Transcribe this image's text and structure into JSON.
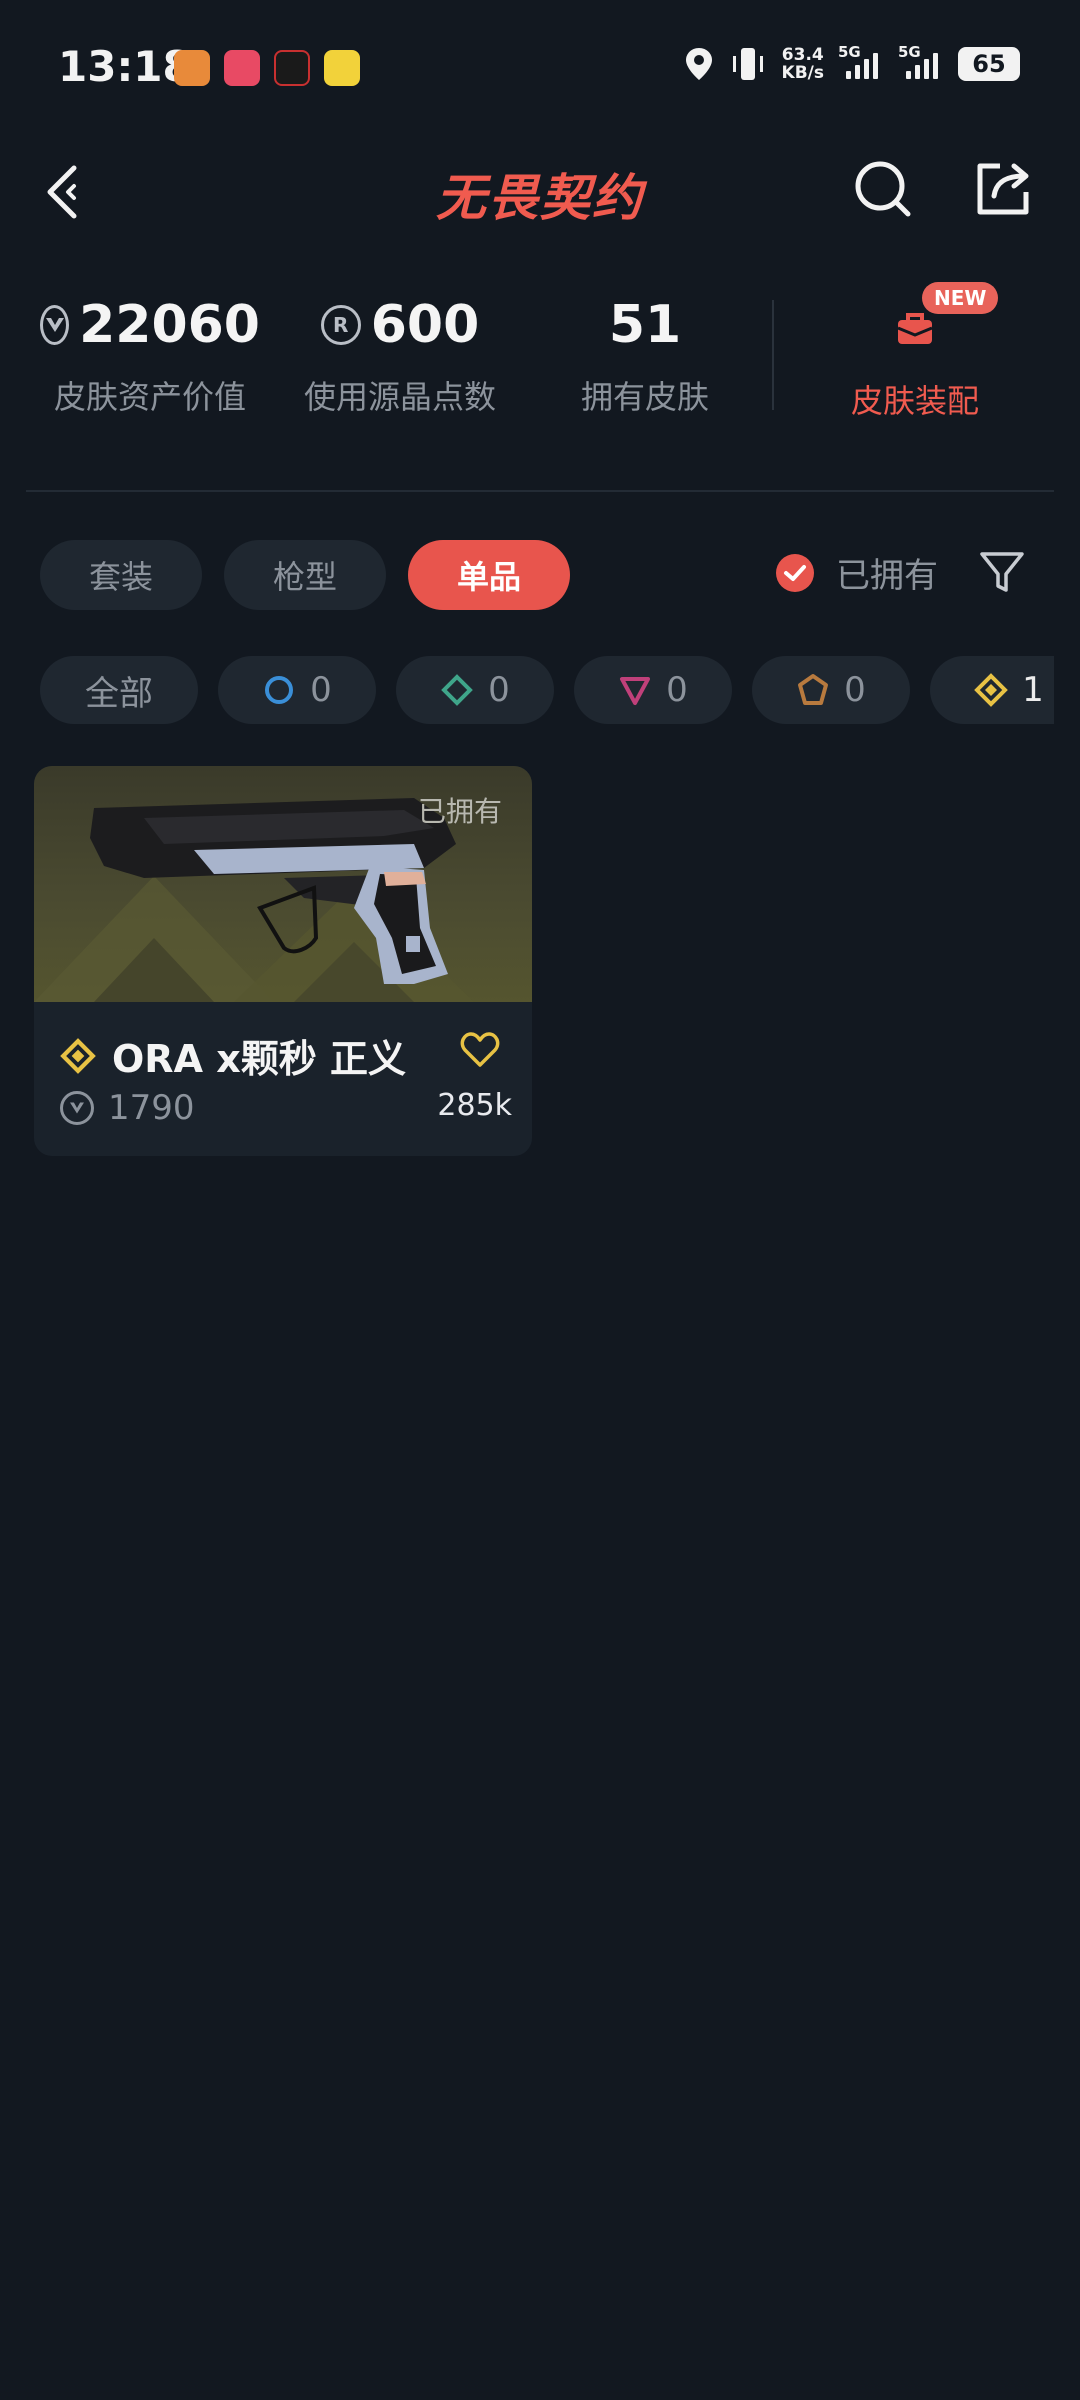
{
  "status_bar": {
    "time": "13:18",
    "net_speed_value": "63.4",
    "net_speed_unit": "KB/s",
    "signal1_label": "5G",
    "signal2_label": "5G",
    "battery": "65"
  },
  "header": {
    "title": "无畏契约"
  },
  "stats": {
    "asset_value": "22060",
    "asset_value_label": "皮肤资产价值",
    "radianite_points": "600",
    "radianite_points_label": "使用源晶点数",
    "owned_skins": "51",
    "owned_skins_label": "拥有皮肤",
    "loadout_label": "皮肤装配",
    "new_badge": "NEW"
  },
  "tabs": [
    {
      "label": "套装",
      "active": false
    },
    {
      "label": "枪型",
      "active": false
    },
    {
      "label": "单品",
      "active": true
    }
  ],
  "owned_filter": {
    "label": "已拥有",
    "checked": true
  },
  "tier_filters": [
    {
      "label": "全部"
    },
    {
      "icon": "select-tier-icon",
      "count": "0",
      "color": "#3a8fd8"
    },
    {
      "icon": "deluxe-tier-icon",
      "count": "0",
      "color": "#3fa58a"
    },
    {
      "icon": "premium-tier-icon",
      "count": "0",
      "color": "#c0407a"
    },
    {
      "icon": "ultra-tier-icon",
      "count": "0",
      "color": "#b87a3e"
    },
    {
      "icon": "exclusive-tier-icon",
      "count": "1",
      "color": "#e8c244"
    }
  ],
  "items": [
    {
      "owned_tag": "已拥有",
      "name": "ORA x颗秒 正义",
      "price": "1790",
      "likes": "285k"
    }
  ],
  "colors": {
    "accent": "#e8554d",
    "background": "#121820",
    "chip": "#1f2730",
    "muted_text": "#8c939c"
  }
}
